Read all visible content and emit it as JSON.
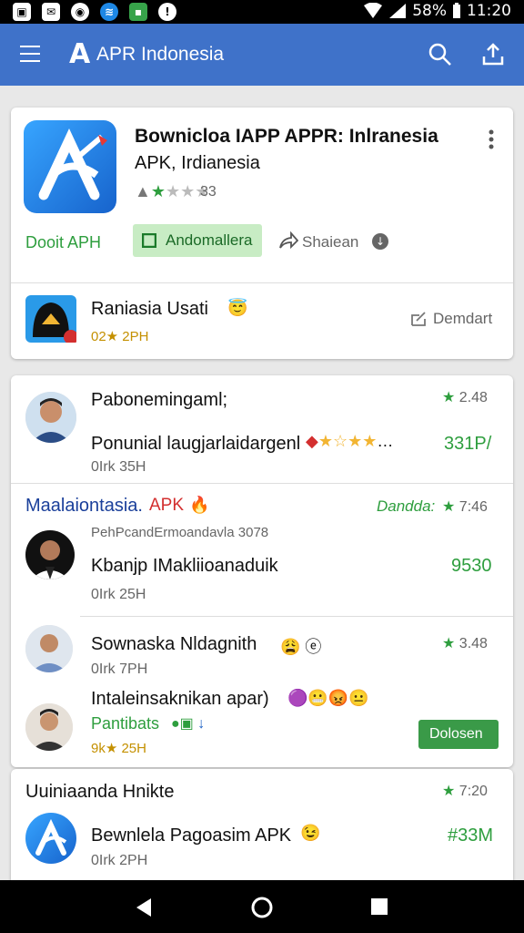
{
  "status_bar": {
    "battery": "58%",
    "time": "11:20"
  },
  "app_bar": {
    "title": "APR Indonesia"
  },
  "featured": {
    "title": "Bownicloa IAPP APPR: Inlranesia",
    "subtitle": "APK, Irdianesia",
    "rating_count": "33",
    "download_link": "Dooit APH",
    "install_button": "Andomallera",
    "share_label": "Shaiean",
    "related": {
      "title": "Raniasia Usati",
      "rating": "02★ 2PH",
      "action": "Demdart"
    }
  },
  "list": {
    "items": [
      {
        "title": "Pabonemingaml;",
        "rating": "2.48",
        "description": "Ponunial laugjarlaidargenl",
        "meta": "0Irk 35H",
        "price": "331P/"
      }
    ],
    "section": {
      "title": "Maalaiontasia.",
      "badge": "APK",
      "right_label": "Dandda:",
      "right_rating": "7:46",
      "subtitle": "PehPcandErmoandavla 3078",
      "item": {
        "title": "Kbanjp IMakliioanaduik",
        "meta": "0Irk 25H",
        "price": "9530"
      }
    },
    "item3": {
      "title": "Sownaska Nldagnith",
      "rating": "3.48",
      "meta": "0Irk 7PH",
      "desc": "Intaleinsaknikan apar)",
      "tag": "Pantibats",
      "rating2": "9k★ 25H",
      "button": "Dolosen"
    }
  },
  "bottom_card": {
    "header": "Uuiniaanda Hnikte",
    "rating": "7:20",
    "title": "Bewnlela Pagoasim APK",
    "meta": "0Irk 2PH",
    "price": "#33M"
  }
}
